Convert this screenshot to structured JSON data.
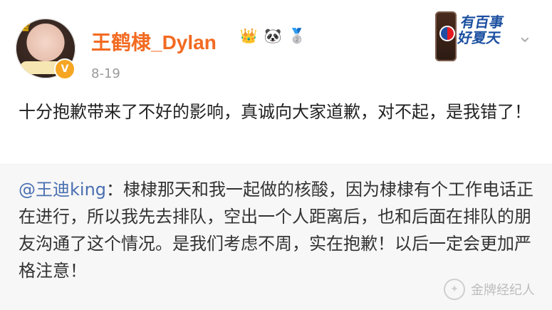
{
  "post": {
    "username": "王鹤棣_Dylan",
    "date": "8-19",
    "text": "十分抱歉带来了不好的影响，真诚向大家道歉，对不起，是我错了！",
    "badges": [
      "crown-medal-icon",
      "panda-icon",
      "silver-medal-icon"
    ],
    "ad_text": "有百事 好夏天"
  },
  "repost": {
    "mention": "@王迪king",
    "text": "：棣棣那天和我一起做的核酸，因为棣棣有个工作电话正在进行，所以我先去排队，空出一个人距离后，也和后面在排队的朋友沟通了这个情况。是我们考虑不周，实在抱歉！以后一定会更加严格注意！"
  },
  "watermark": {
    "text": "金牌经纪人"
  },
  "colors": {
    "username": "#f26a21",
    "mention": "#4a6fb1",
    "repost_bg": "#f7f7f7"
  }
}
